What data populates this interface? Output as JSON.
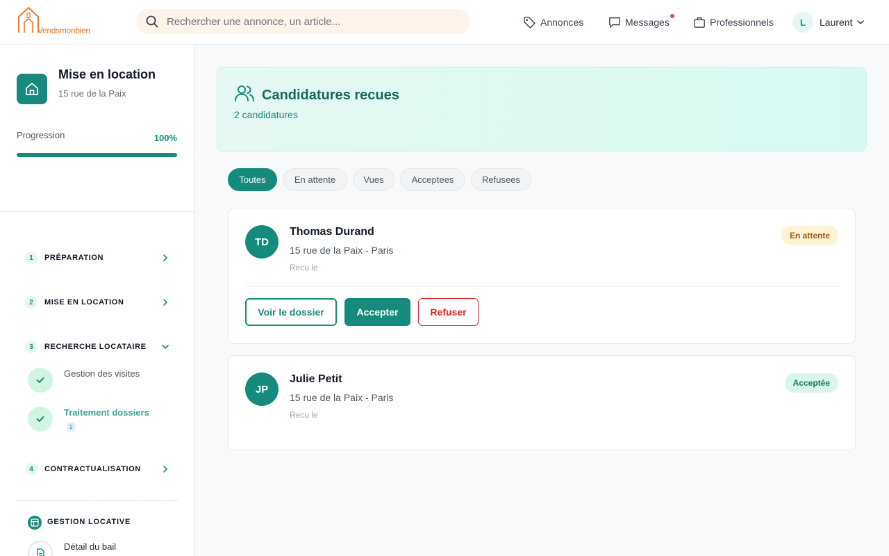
{
  "brand": {
    "name": "Vendsmonbien",
    "accent": "#168a7c",
    "orange": "#e8782a"
  },
  "search": {
    "placeholder": "Rechercher une annonce, un article..."
  },
  "nav": {
    "annonces": "Annonces",
    "messages": "Messages",
    "professionnels": "Professionnels",
    "user_initial": "L",
    "user_name": "Laurent"
  },
  "sidebar": {
    "project_title": "Mise en location",
    "project_address": "15 rue de la Paix",
    "progress_label": "Progression",
    "progress_value": "100%",
    "progress_fraction": 1.0,
    "steps": [
      {
        "num": "1",
        "label": "PRÉPARATION",
        "expanded": false
      },
      {
        "num": "2",
        "label": "MISE EN LOCATION",
        "expanded": false
      },
      {
        "num": "3",
        "label": "RECHERCHE LOCATAIRE",
        "expanded": true
      },
      {
        "num": "4",
        "label": "CONTRACTUALISATION",
        "expanded": false
      }
    ],
    "substeps": [
      {
        "label": "Gestion des visites",
        "done": true
      },
      {
        "label": "Traitement dossiers",
        "done": true,
        "active": true,
        "badge": "1"
      }
    ],
    "section_label": "GESTION LOCATIVE",
    "section_items": [
      {
        "label": "Détail du bail"
      }
    ]
  },
  "main": {
    "title": "Candidatures recues",
    "count": "2 candidatures",
    "filters": [
      {
        "label": "Toutes",
        "active": true
      },
      {
        "label": "En attente",
        "active": false
      },
      {
        "label": "Vues",
        "active": false
      },
      {
        "label": "Acceptees",
        "active": false
      },
      {
        "label": "Refusees",
        "active": false
      }
    ],
    "candidates": [
      {
        "initials": "TD",
        "name": "Thomas Durand",
        "address": "15 rue de la Paix - Paris",
        "received": "Recu le",
        "status": "En attente",
        "actions": {
          "view": "Voir le dossier",
          "accept": "Accepter",
          "refuse": "Refuser"
        }
      },
      {
        "initials": "JP",
        "name": "Julie Petit",
        "address": "15 rue de la Paix - Paris",
        "received": "Recu le",
        "status": "Acceptée"
      }
    ]
  }
}
